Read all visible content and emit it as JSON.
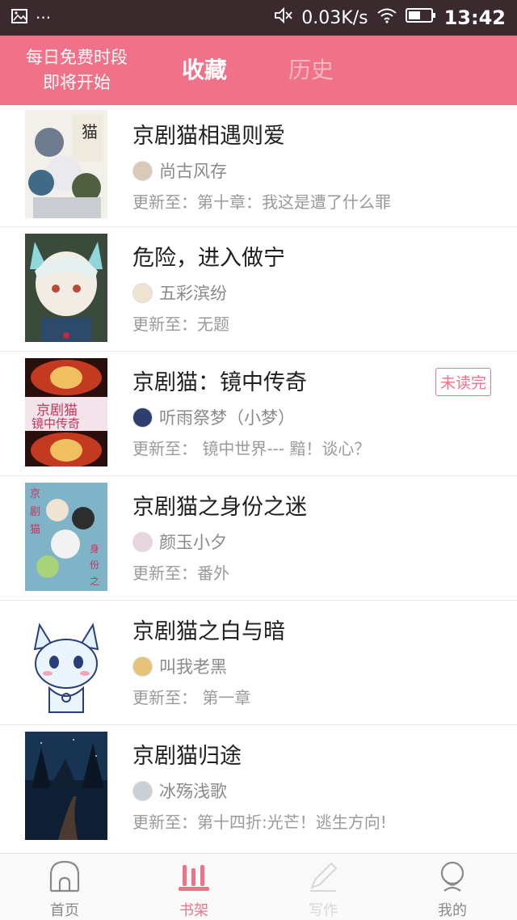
{
  "status_bar": {
    "net_speed": "0.03K/s",
    "time": "13:42",
    "dots": "···"
  },
  "header": {
    "promo_line1": "每日免费时段",
    "promo_line2": "即将开始",
    "tab_favorites": "收藏",
    "tab_history": "历史",
    "accent_color": "#ef7289"
  },
  "books": [
    {
      "title": "京剧猫相遇则爱",
      "author": "尚古风存",
      "update": "更新至：第十章：我这是遭了什么罪",
      "badge": ""
    },
    {
      "title": "危险，进入做宁",
      "author": "五彩滨纷",
      "update": "更新至：无题",
      "badge": ""
    },
    {
      "title": "京剧猫：镜中传奇",
      "author": "听雨祭梦（小梦）",
      "update": "更新至： 镜中世界--- 黯！谈心？",
      "badge": "未读完"
    },
    {
      "title": "京剧猫之身份之迷",
      "author": "颜玉小夕",
      "update": "更新至：番外",
      "badge": ""
    },
    {
      "title": "京剧猫之白与暗",
      "author": "叫我老黑",
      "update": "更新至： 第一章",
      "badge": ""
    },
    {
      "title": "京剧猫归途",
      "author": "冰殇浅歌",
      "update": "更新至：第十四折:光芒！逃生方向!",
      "badge": ""
    }
  ],
  "bottom_nav": {
    "home": "首页",
    "shelf": "书架",
    "write": "写作",
    "mine": "我的"
  }
}
